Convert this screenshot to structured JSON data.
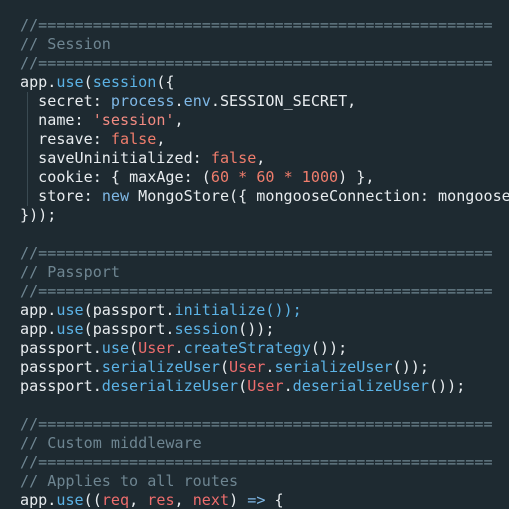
{
  "editor": {
    "lines": [
      [
        {
          "t": "//==================================================",
          "c": "comment"
        }
      ],
      [
        {
          "t": "// Session",
          "c": "comment"
        }
      ],
      [
        {
          "t": "//==================================================",
          "c": "comment"
        }
      ],
      [
        {
          "t": "app",
          "c": "plain"
        },
        {
          "t": ".",
          "c": "punct"
        },
        {
          "t": "use",
          "c": "method"
        },
        {
          "t": "(",
          "c": "punct"
        },
        {
          "t": "session",
          "c": "method"
        },
        {
          "t": "({",
          "c": "punct"
        }
      ],
      [
        {
          "t": "  secret",
          "c": "key"
        },
        {
          "t": ": ",
          "c": "punct"
        },
        {
          "t": "process",
          "c": "keyword"
        },
        {
          "t": ".",
          "c": "punct"
        },
        {
          "t": "env",
          "c": "keyword"
        },
        {
          "t": ".SESSION_SECRET,",
          "c": "plain"
        }
      ],
      [
        {
          "t": "  name",
          "c": "key"
        },
        {
          "t": ": ",
          "c": "punct"
        },
        {
          "t": "'session'",
          "c": "string"
        },
        {
          "t": ",",
          "c": "punct"
        }
      ],
      [
        {
          "t": "  resave",
          "c": "key"
        },
        {
          "t": ": ",
          "c": "punct"
        },
        {
          "t": "false",
          "c": "bool"
        },
        {
          "t": ",",
          "c": "punct"
        }
      ],
      [
        {
          "t": "  saveUninitialized",
          "c": "key"
        },
        {
          "t": ": ",
          "c": "punct"
        },
        {
          "t": "false",
          "c": "bool"
        },
        {
          "t": ",",
          "c": "punct"
        }
      ],
      [
        {
          "t": "  cookie",
          "c": "key"
        },
        {
          "t": ": { ",
          "c": "punct"
        },
        {
          "t": "maxAge",
          "c": "key"
        },
        {
          "t": ": (",
          "c": "punct"
        },
        {
          "t": "60",
          "c": "num"
        },
        {
          "t": " * ",
          "c": "op"
        },
        {
          "t": "60",
          "c": "num"
        },
        {
          "t": " * ",
          "c": "op"
        },
        {
          "t": "1000",
          "c": "num"
        },
        {
          "t": ") },",
          "c": "punct"
        }
      ],
      [
        {
          "t": "  store",
          "c": "key"
        },
        {
          "t": ": ",
          "c": "punct"
        },
        {
          "t": "new",
          "c": "keyword"
        },
        {
          "t": " MongoStore({ mongooseConnection: mongoose.connection })",
          "c": "plain"
        }
      ],
      [
        {
          "t": "}));",
          "c": "punct"
        }
      ],
      [
        {
          "t": "",
          "c": "plain"
        }
      ],
      [
        {
          "t": "//==================================================",
          "c": "comment"
        }
      ],
      [
        {
          "t": "// Passport",
          "c": "comment"
        }
      ],
      [
        {
          "t": "//==================================================",
          "c": "comment"
        }
      ],
      [
        {
          "t": "app",
          "c": "plain"
        },
        {
          "t": ".",
          "c": "punct"
        },
        {
          "t": "use",
          "c": "method"
        },
        {
          "t": "(passport.",
          "c": "punct"
        },
        {
          "t": "initialize",
          "c": "method"
        },
        {
          "t": "());",
          "c": "method"
        }
      ],
      [
        {
          "t": "app",
          "c": "plain"
        },
        {
          "t": ".",
          "c": "punct"
        },
        {
          "t": "use",
          "c": "method"
        },
        {
          "t": "(passport.",
          "c": "punct"
        },
        {
          "t": "session",
          "c": "method"
        },
        {
          "t": "());",
          "c": "punct"
        }
      ],
      [
        {
          "t": "passport",
          "c": "plain"
        },
        {
          "t": ".",
          "c": "punct"
        },
        {
          "t": "use",
          "c": "method"
        },
        {
          "t": "(",
          "c": "punct"
        },
        {
          "t": "User",
          "c": "class"
        },
        {
          "t": ".",
          "c": "punct"
        },
        {
          "t": "createStrategy",
          "c": "method"
        },
        {
          "t": "());",
          "c": "punct"
        }
      ],
      [
        {
          "t": "passport",
          "c": "plain"
        },
        {
          "t": ".",
          "c": "punct"
        },
        {
          "t": "serializeUser",
          "c": "method"
        },
        {
          "t": "(",
          "c": "punct"
        },
        {
          "t": "User",
          "c": "class"
        },
        {
          "t": ".",
          "c": "punct"
        },
        {
          "t": "serializeUser",
          "c": "method"
        },
        {
          "t": "());",
          "c": "punct"
        }
      ],
      [
        {
          "t": "passport",
          "c": "plain"
        },
        {
          "t": ".",
          "c": "punct"
        },
        {
          "t": "deserializeUser",
          "c": "method"
        },
        {
          "t": "(",
          "c": "punct"
        },
        {
          "t": "User",
          "c": "class"
        },
        {
          "t": ".",
          "c": "punct"
        },
        {
          "t": "deserializeUser",
          "c": "method"
        },
        {
          "t": "());",
          "c": "punct"
        }
      ],
      [
        {
          "t": "",
          "c": "plain"
        }
      ],
      [
        {
          "t": "//==================================================",
          "c": "comment"
        }
      ],
      [
        {
          "t": "// Custom middleware",
          "c": "comment"
        }
      ],
      [
        {
          "t": "//==================================================",
          "c": "comment"
        }
      ],
      [
        {
          "t": "// Applies to all routes",
          "c": "comment"
        }
      ],
      [
        {
          "t": "app",
          "c": "plain"
        },
        {
          "t": ".",
          "c": "punct"
        },
        {
          "t": "use",
          "c": "method"
        },
        {
          "t": "((",
          "c": "punct"
        },
        {
          "t": "req",
          "c": "class"
        },
        {
          "t": ", ",
          "c": "punct"
        },
        {
          "t": "res",
          "c": "class"
        },
        {
          "t": ", ",
          "c": "punct"
        },
        {
          "t": "next",
          "c": "class"
        },
        {
          "t": ") ",
          "c": "punct"
        },
        {
          "t": "=>",
          "c": "keyword"
        },
        {
          "t": " {",
          "c": "punct"
        }
      ]
    ]
  },
  "colors": {
    "background": "#1e2a31",
    "comment": "#6e8591",
    "method": "#5cb3e6",
    "string": "#f28b82",
    "boolean": "#f07d6c",
    "class": "#ee6d6d"
  }
}
